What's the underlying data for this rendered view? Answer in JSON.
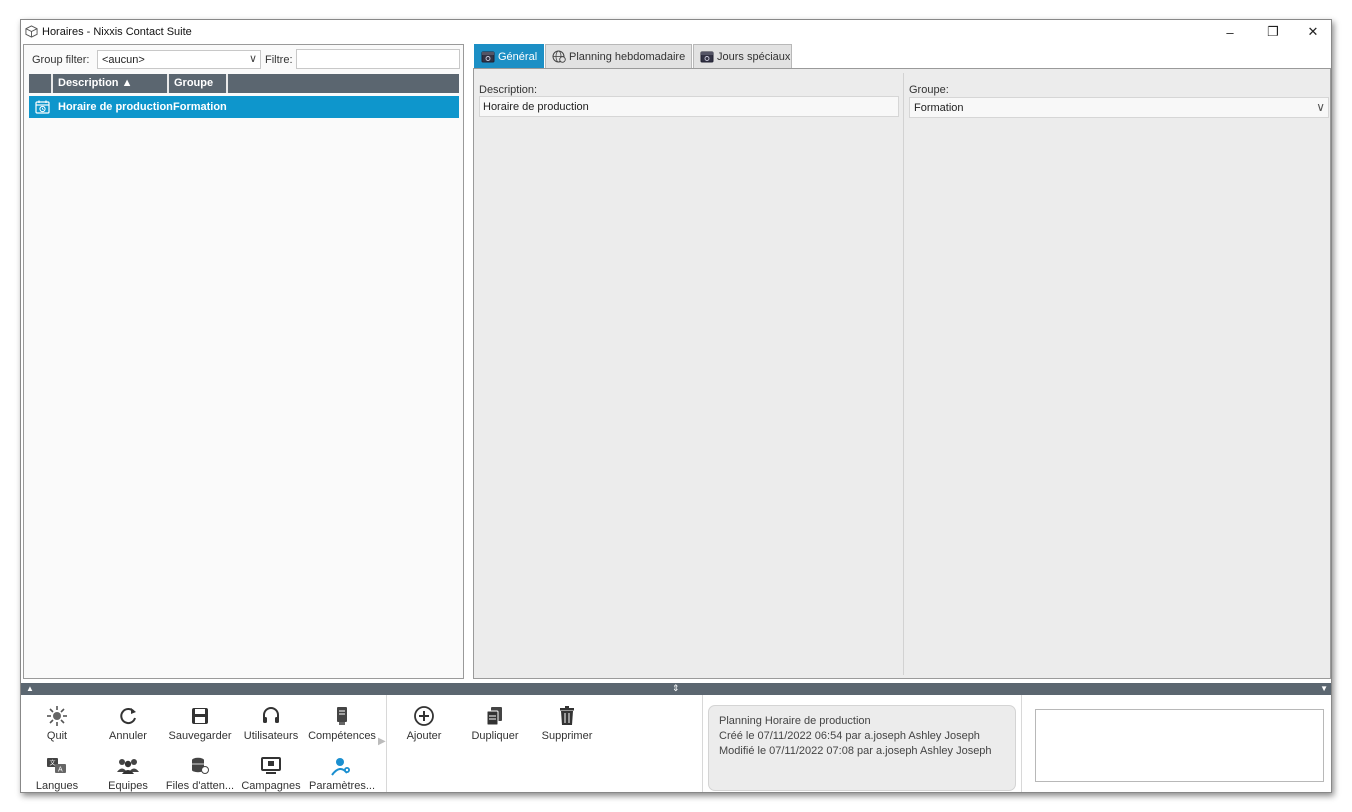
{
  "window": {
    "title": "Horaires - Nixxis Contact Suite",
    "controls": {
      "minimize": "–",
      "maximize": "❐",
      "close": "✕"
    }
  },
  "filter": {
    "group_filter_label": "Group filter:",
    "group_filter_value": "<aucun>",
    "filtre_label": "Filtre:",
    "filtre_value": ""
  },
  "list": {
    "columns": [
      "Description ▲",
      "Groupe"
    ],
    "rows": [
      {
        "description": "Horaire de production",
        "groupe": "Formation",
        "selected": true
      }
    ]
  },
  "tabs": [
    "Général",
    "Planning hebdomadaire",
    "Jours spéciaux"
  ],
  "general": {
    "description_label": "Description:",
    "description_value": "Horaire de production",
    "groupe_label": "Groupe:",
    "groupe_value": "Formation"
  },
  "toolbar": {
    "quit": "Quit",
    "annuler": "Annuler",
    "sauvegarder": "Sauvegarder",
    "utilisateurs": "Utilisateurs",
    "competences": "Compétences",
    "langues": "Langues",
    "equipes": "Equipes",
    "files": "Files d'atten...",
    "campagnes": "Campagnes",
    "parametres": "Paramètres...",
    "ajouter": "Ajouter",
    "dupliquer": "Dupliquer",
    "supprimer": "Supprimer"
  },
  "info": {
    "line1": "Planning Horaire de production",
    "line2": "Créé le 07/11/2022 06:54 par a.joseph Ashley Joseph",
    "line3": "Modifié le 07/11/2022 07:08 par a.joseph Ashley Joseph"
  },
  "colors": {
    "accent": "#0e96cc",
    "header": "#5b6670",
    "panel": "#ececec"
  }
}
